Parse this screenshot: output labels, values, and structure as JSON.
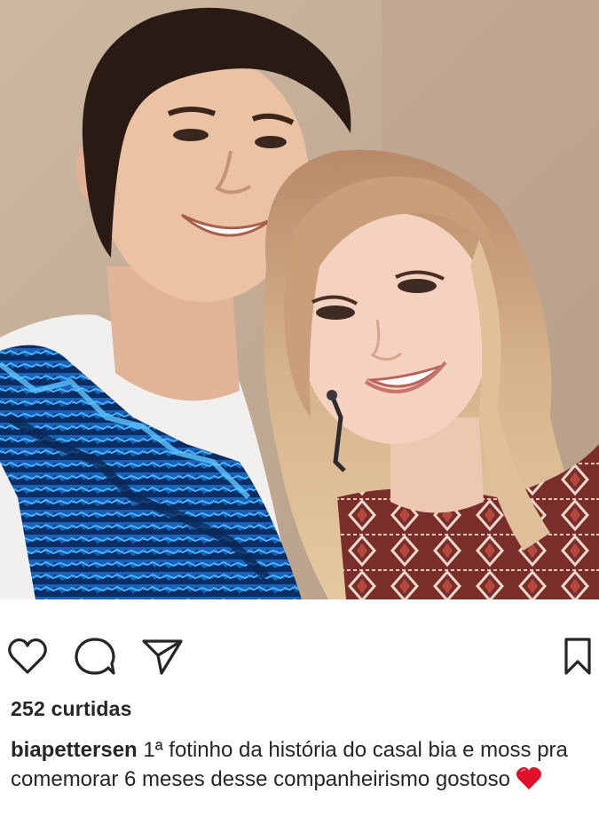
{
  "post": {
    "likes_text": "252 curtidas",
    "caption": {
      "username": "biapettersen",
      "text": "1ª fotinho da história do casal bia e moss pra comemorar 6 meses desse companheirismo gostoso",
      "emoji": "red-heart"
    }
  },
  "icons": {
    "like": "heart-outline-icon",
    "comment": "speech-bubble-icon",
    "share": "paper-plane-icon",
    "save": "bookmark-icon"
  },
  "colors": {
    "text": "#262626",
    "heart_emoji": "#e0102b"
  }
}
